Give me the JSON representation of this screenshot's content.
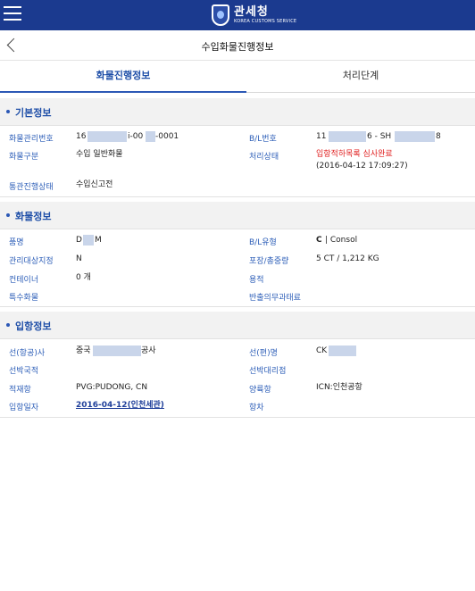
{
  "header": {
    "logo_kr": "관세청",
    "logo_en": "KOREA CUSTOMS SERVICE",
    "page_title": "수입화물진행정보"
  },
  "tabs": [
    {
      "label": "화물진행정보",
      "active": true
    },
    {
      "label": "처리단계",
      "active": false
    }
  ],
  "sections": {
    "basic": {
      "title": "기본정보",
      "cargo_no_label": "화물관리번호",
      "cargo_no_a": "16",
      "cargo_no_b": "i-00",
      "cargo_no_c": "-0001",
      "bl_no_label": "B/L번호",
      "bl_no_a": "11",
      "bl_no_b": "6 - SH",
      "bl_no_c": "8",
      "cargo_type_label": "화물구분",
      "cargo_type": "수입 일반화물",
      "status_label": "처리상태",
      "status": "입항적하목록 심사완료",
      "status_time": "(2016-04-12 17:09:27)",
      "clearance_label": "통관진행상태",
      "clearance": "수입신고전"
    },
    "cargo": {
      "title": "화물정보",
      "item_label": "품명",
      "item_a": "D",
      "item_b": "M",
      "bl_type_label": "B/L유형",
      "bl_type_code": "C",
      "bl_type_text": "| Consol",
      "managed_label": "관리대상지정",
      "managed": "N",
      "package_label": "포장/총중량",
      "package": "5 CT / 1,212 KG",
      "container_label": "컨테이너",
      "container": "0 개",
      "volume_label": "용적",
      "volume": "",
      "special_label": "특수화물",
      "special": "",
      "fee_label": "반출의무과태료",
      "fee": ""
    },
    "port": {
      "title": "입항정보",
      "carrier_label": "선(항공)사",
      "carrier_a": "중국",
      "carrier_b": "공사",
      "vessel_label": "선(편)명",
      "vessel": "CK",
      "nationality_label": "선박국적",
      "nationality": "",
      "agent_label": "선박대리점",
      "agent": "",
      "loading_label": "적재항",
      "loading": "PVG:PUDONG, CN",
      "unloading_label": "양륙항",
      "unloading": "ICN:인천공항",
      "arrival_label": "입항일자",
      "arrival": "2016-04-12(인천세관)",
      "voyage_label": "항차",
      "voyage": ""
    }
  },
  "colors": {
    "header_bg": "#1b3a8f",
    "accent": "#2b58b5",
    "label_blue": "#2e5fb8",
    "status_red": "#e02020"
  }
}
